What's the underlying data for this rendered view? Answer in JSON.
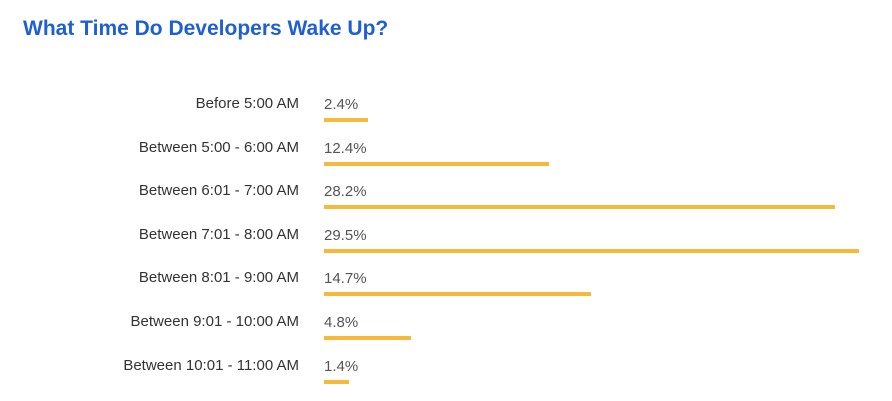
{
  "title": "What Time Do Developers Wake Up?",
  "colors": {
    "title": "#1f5fd6",
    "bar": "#f6b939"
  },
  "chart_data": {
    "type": "bar",
    "orientation": "horizontal",
    "title": "What Time Do Developers Wake Up?",
    "xlabel": "",
    "ylabel": "",
    "categories": [
      "Before 5:00 AM",
      "Between 5:00 - 6:00 AM",
      "Between 6:01 - 7:00 AM",
      "Between 7:01 - 8:00 AM",
      "Between 8:01 - 9:00 AM",
      "Between 9:01 - 10:00 AM",
      "Between 10:01 - 11:00 AM"
    ],
    "values": [
      2.4,
      12.4,
      28.2,
      29.5,
      14.7,
      4.8,
      1.4
    ],
    "value_labels": [
      "2.4%",
      "12.4%",
      "28.2%",
      "29.5%",
      "14.7%",
      "4.8%",
      "1.4%"
    ],
    "xlim": [
      0,
      29.5
    ],
    "grid": false,
    "legend": "none"
  }
}
